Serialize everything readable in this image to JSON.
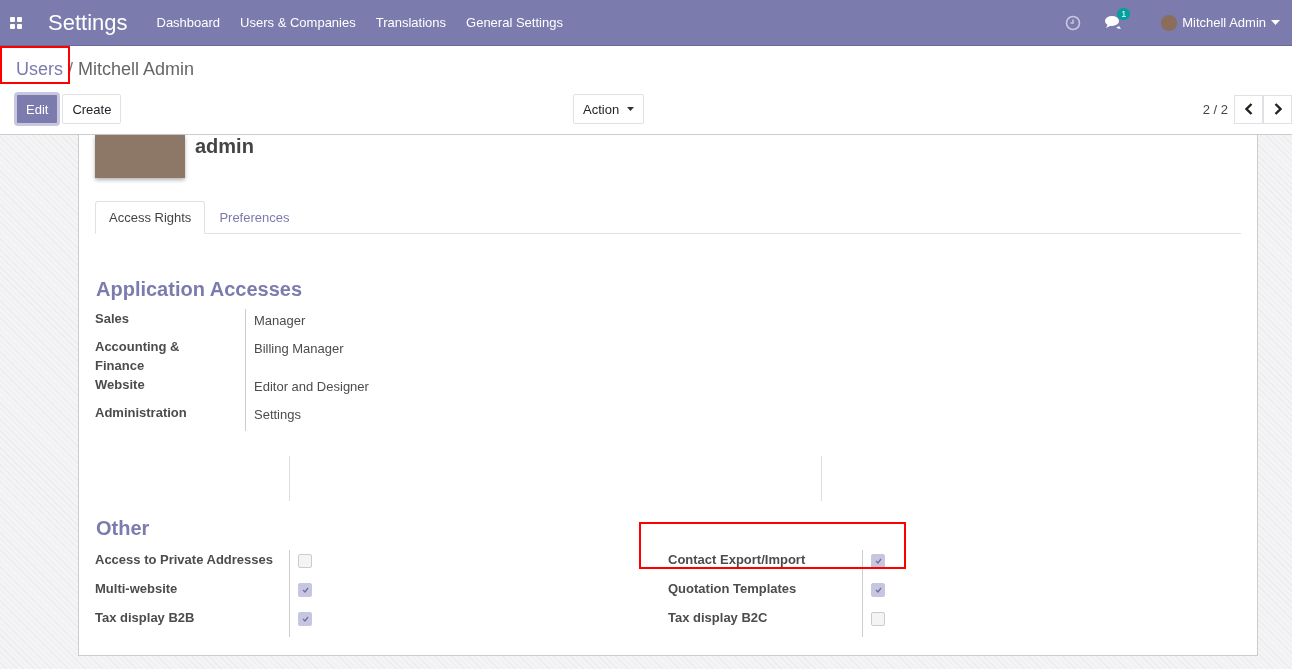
{
  "navbar": {
    "app_title": "Settings",
    "menu": [
      {
        "label": "Dashboard"
      },
      {
        "label": "Users & Companies"
      },
      {
        "label": "Translations"
      },
      {
        "label": "General Settings"
      }
    ],
    "messages_badge": "1",
    "user": "Mitchell Admin"
  },
  "breadcrumb": [
    {
      "label": "Users"
    },
    {
      "label": "Mitchell Admin"
    }
  ],
  "breadcrumb_separator": "/",
  "buttons": {
    "edit": "Edit",
    "create": "Create",
    "action": "Action"
  },
  "pager": "2 / 2",
  "record": {
    "name": "admin"
  },
  "tabs": [
    {
      "label": "Access Rights",
      "selected": true
    },
    {
      "label": "Preferences",
      "selected": false
    }
  ],
  "application_accesses": {
    "title": "Application Accesses",
    "rows": [
      {
        "label": "Sales",
        "value": "Manager"
      },
      {
        "label": "Accounting & Finance",
        "value": "Billing Manager"
      },
      {
        "label": "Website",
        "value": "Editor and Designer"
      },
      {
        "label": "Administration",
        "value": "Settings"
      }
    ]
  },
  "other": {
    "title": "Other",
    "left": [
      {
        "label": "Access to Private Addresses",
        "checked": false
      },
      {
        "label": "Multi-website",
        "checked": true
      },
      {
        "label": "Tax display B2B",
        "checked": true
      }
    ],
    "right": [
      {
        "label": "Contact Export/Import",
        "checked": true
      },
      {
        "label": "Quotation Templates",
        "checked": true
      },
      {
        "label": "Tax display B2C",
        "checked": false
      }
    ]
  }
}
